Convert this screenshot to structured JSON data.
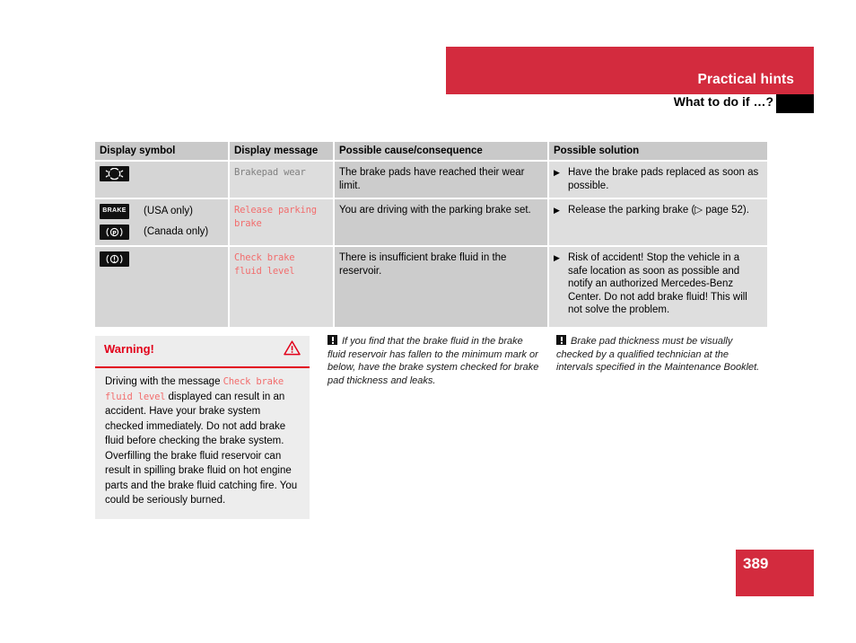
{
  "header": {
    "chapter": "Practical hints",
    "section": "What to do if …?",
    "band_color": "#d32b3e",
    "tab_color": "#000000"
  },
  "table": {
    "columns": [
      "Display symbol",
      "Display message",
      "Possible cause/consequence",
      "Possible solution"
    ],
    "rows": [
      {
        "symbols": [
          {
            "icon": "brakepad-wear-icon",
            "label": ""
          }
        ],
        "message": "Brakepad wear",
        "message_color": "#808080",
        "cause": "The brake pads have reached their wear limit.",
        "solution": "Have the brake pads replaced as soon as possible.",
        "solution_marker": "▶"
      },
      {
        "symbols": [
          {
            "icon": "brake-word-icon",
            "label": "(USA only)"
          },
          {
            "icon": "parking-brake-p-icon",
            "label": "(Canada only)"
          }
        ],
        "message": "Release parking brake",
        "message_color": "#f26d6d",
        "cause": "You are driving with the parking brake set.",
        "solution": "Release the parking brake (▷ page 52).",
        "solution_marker": "▶"
      },
      {
        "symbols": [
          {
            "icon": "brake-fluid-icon",
            "label": ""
          }
        ],
        "message": "Check brake fluid level",
        "message_color": "#f26d6d",
        "cause": "There is insufficient brake fluid in the reservoir.",
        "solution": "Risk of accident! Stop the vehicle in a safe location as soon as possible and notify an authorized Mercedes-Benz Center. Do not add brake fluid! This will not solve the problem.",
        "solution_marker": "▶"
      }
    ]
  },
  "warning": {
    "title": "Warning!",
    "icon": "warning-triangle-icon",
    "accent_color": "#e2001a",
    "text_before": "Driving with the message ",
    "inline_message": "Check brake fluid level",
    "text_after": " displayed can result in an accident. Have your brake system checked immediately. Do not add brake fluid before checking the brake system. Overfilling the brake fluid reservoir can result in spilling brake fluid on hot engine parts and the brake fluid catching fire. You could be seriously burned."
  },
  "notes": [
    {
      "icon": "exclamation-note-icon",
      "text": "If you find that the brake fluid in the brake fluid reservoir has fallen to the minimum mark or below, have the brake system checked for brake pad thickness and leaks."
    },
    {
      "icon": "exclamation-note-icon",
      "text": "Brake pad thickness must be visually checked by a qualified technician at the intervals specified in the Maintenance Booklet."
    }
  ],
  "footer": {
    "page_number": "389",
    "color": "#d32b3e"
  }
}
